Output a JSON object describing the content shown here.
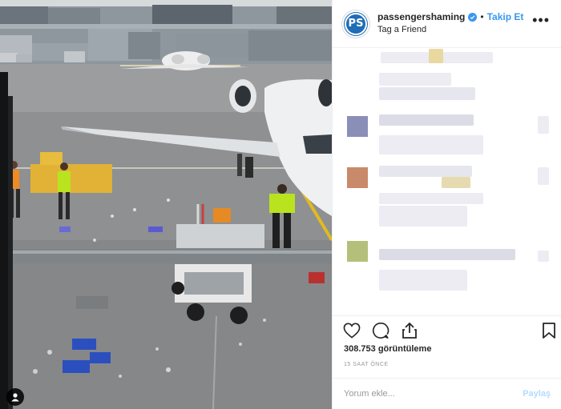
{
  "post": {
    "username": "passengershaming",
    "avatar_text": "PS",
    "separator": "•",
    "follow_label": "Takip Et",
    "location": "Tag a Friend",
    "more_icon": "ellipsis-icon",
    "views": "308.753 görüntüleme",
    "time_ago": "15 SAAT ÖNCE"
  },
  "actions": {
    "icons": [
      "heart-icon",
      "comment-icon",
      "share-icon",
      "bookmark-icon"
    ]
  },
  "comment_box": {
    "placeholder": "Yorum ekle...",
    "post_label": "Paylaş"
  },
  "colors": {
    "accent": "#3897f0",
    "avatar_bg": "#1f6db6",
    "post_disabled": "#b3dbff",
    "vest": "#b9e31f"
  }
}
